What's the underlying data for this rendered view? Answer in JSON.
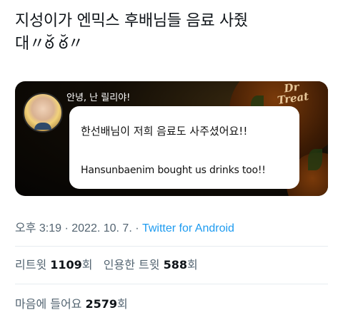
{
  "tweet": {
    "text_line1": "지성이가 엔믹스 후배님들 음료 사줬",
    "text_line2": "대〃ఠ̆ ఠ̆〃"
  },
  "media": {
    "sign_text_1": "Dr",
    "sign_text_2": "Treat",
    "speaker": "안녕, 난 릴리야!",
    "bubble_korean": "한선배님이 저희 음료도 사주셨어요!!",
    "bubble_english": "Hansunbaenim bought us drinks too!!"
  },
  "meta": {
    "time": "오후 3:19",
    "separator1": " · ",
    "date": "2022. 10. 7.",
    "separator2": " · ",
    "source": "Twitter for Android"
  },
  "stats": {
    "retweets_label": "리트윗 ",
    "retweets_count": "1109",
    "retweets_suffix": "회",
    "quotes_label": "인용한 트윗 ",
    "quotes_count": "588",
    "quotes_suffix": "회"
  },
  "likes": {
    "label": "마음에 들어요 ",
    "count": "2579",
    "suffix": "회"
  }
}
